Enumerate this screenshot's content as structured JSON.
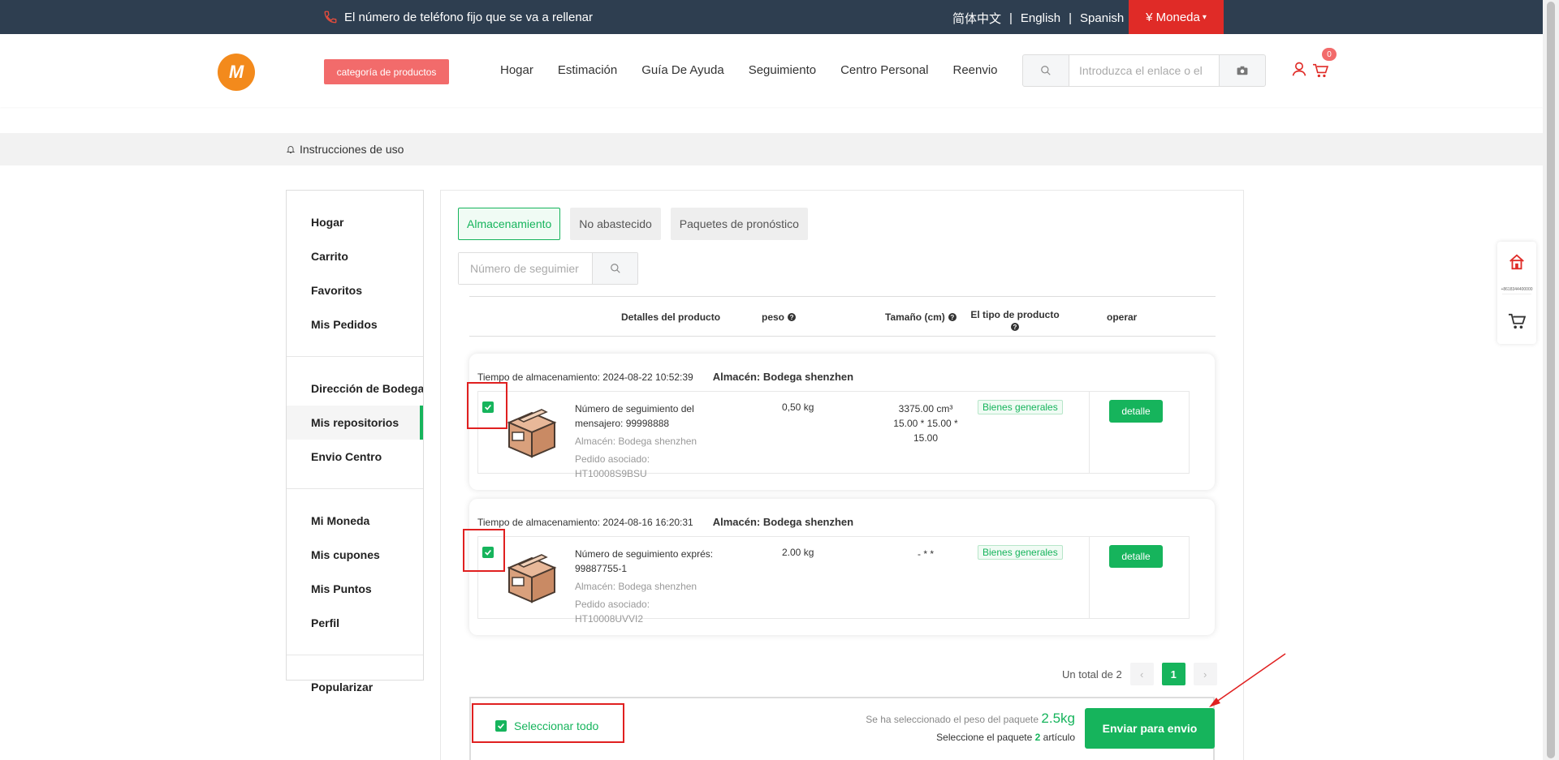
{
  "topbar": {
    "phone_text": "El número de teléfono fijo que se va a rellenar",
    "languages": [
      "简体中文",
      "English",
      "Spanish"
    ],
    "currency": "¥ Moneda"
  },
  "header": {
    "logo_letter": "M",
    "category_button": "categoría de productos",
    "nav": [
      "Hogar",
      "Estimación",
      "Guía De Ayuda",
      "Seguimiento",
      "Centro Personal",
      "Reenvio"
    ],
    "search_placeholder": "Introduzca el enlace o el",
    "cart_count": "0"
  },
  "notice": {
    "text": "Instrucciones de uso"
  },
  "sidebar": {
    "groups": [
      [
        "Hogar",
        "Carrito",
        "Favoritos",
        "Mis Pedidos"
      ],
      [
        "Dirección de Bodega",
        "Mis repositorios",
        "Envio Centro"
      ],
      [
        "Mi Moneda",
        "Mis cupones",
        "Mis Puntos",
        "Perfil"
      ],
      [
        "Popularizar"
      ]
    ],
    "active": "Mis repositorios"
  },
  "tabs": [
    "Almacenamiento",
    "No abastecido",
    "Paquetes de pronóstico"
  ],
  "tracking_search_placeholder": "Número de seguimier",
  "table_headers": {
    "product": "Detalles del producto",
    "weight": "peso",
    "size": "Tamaño (cm)",
    "type": "El tipo de producto",
    "operate": "operar"
  },
  "packages": [
    {
      "storage_time": "Tiempo de almacenamiento: 2024-08-22 10:52:39",
      "warehouse": "Almacén: Bodega shenzhen",
      "tracking": "Número de seguimiento del mensajero: 99998888",
      "warehouse_sub": "Almacén: Bodega shenzhen",
      "order": "Pedido asociado: HT10008S9BSU",
      "weight": "0,50 kg",
      "size": "3375.00 cm³ 15.00 * 15.00 * 15.00",
      "type": "Bienes generales",
      "action": "detalle"
    },
    {
      "storage_time": "Tiempo de almacenamiento: 2024-08-16 16:20:31",
      "warehouse": "Almacén: Bodega shenzhen",
      "tracking": "Número de seguimiento exprés: 99887755-1",
      "warehouse_sub": "Almacén: Bodega shenzhen",
      "order": "Pedido asociado: HT10008UVVI2",
      "weight": "2.00 kg",
      "size": "- * *",
      "type": "Bienes generales",
      "action": "detalle"
    }
  ],
  "pagination": {
    "total_text": "Un total de 2",
    "current": "1",
    "prev": "‹",
    "next": "›"
  },
  "footer": {
    "select_all": "Seleccionar todo",
    "weight_label": "Se ha seleccionado el peso del paquete",
    "weight_value": "2.5kg",
    "select_prefix": "Seleccione el paquete",
    "select_count": "2",
    "select_suffix": "artículo",
    "send_button": "Enviar para envio"
  },
  "float_widget": {
    "tiny_text": "+8618344400000"
  },
  "colors": {
    "green": "#16b45c",
    "red": "#e02b27",
    "topbar": "#2e3e50",
    "pink": "#f26b6b"
  }
}
